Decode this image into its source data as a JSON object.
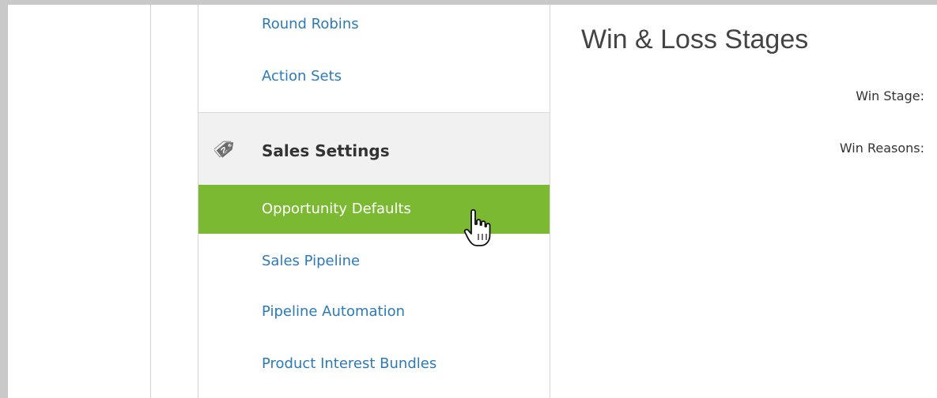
{
  "sidebar": {
    "top_items": [
      {
        "label": "Round Robins"
      },
      {
        "label": "Action Sets"
      }
    ],
    "section": {
      "title": "Sales Settings",
      "icon": "price-tag-icon"
    },
    "active_item": {
      "label": "Opportunity Defaults"
    },
    "items": [
      {
        "label": "Sales Pipeline"
      },
      {
        "label": "Pipeline Automation"
      },
      {
        "label": "Product Interest Bundles"
      }
    ]
  },
  "main": {
    "title": "Win & Loss Stages",
    "fields": [
      {
        "label": "Win Stage:"
      },
      {
        "label": "Win Reasons:"
      }
    ]
  },
  "colors": {
    "active_bg": "#7cb933",
    "link": "#2c7ab7",
    "section_bg": "#f1f1f1"
  }
}
